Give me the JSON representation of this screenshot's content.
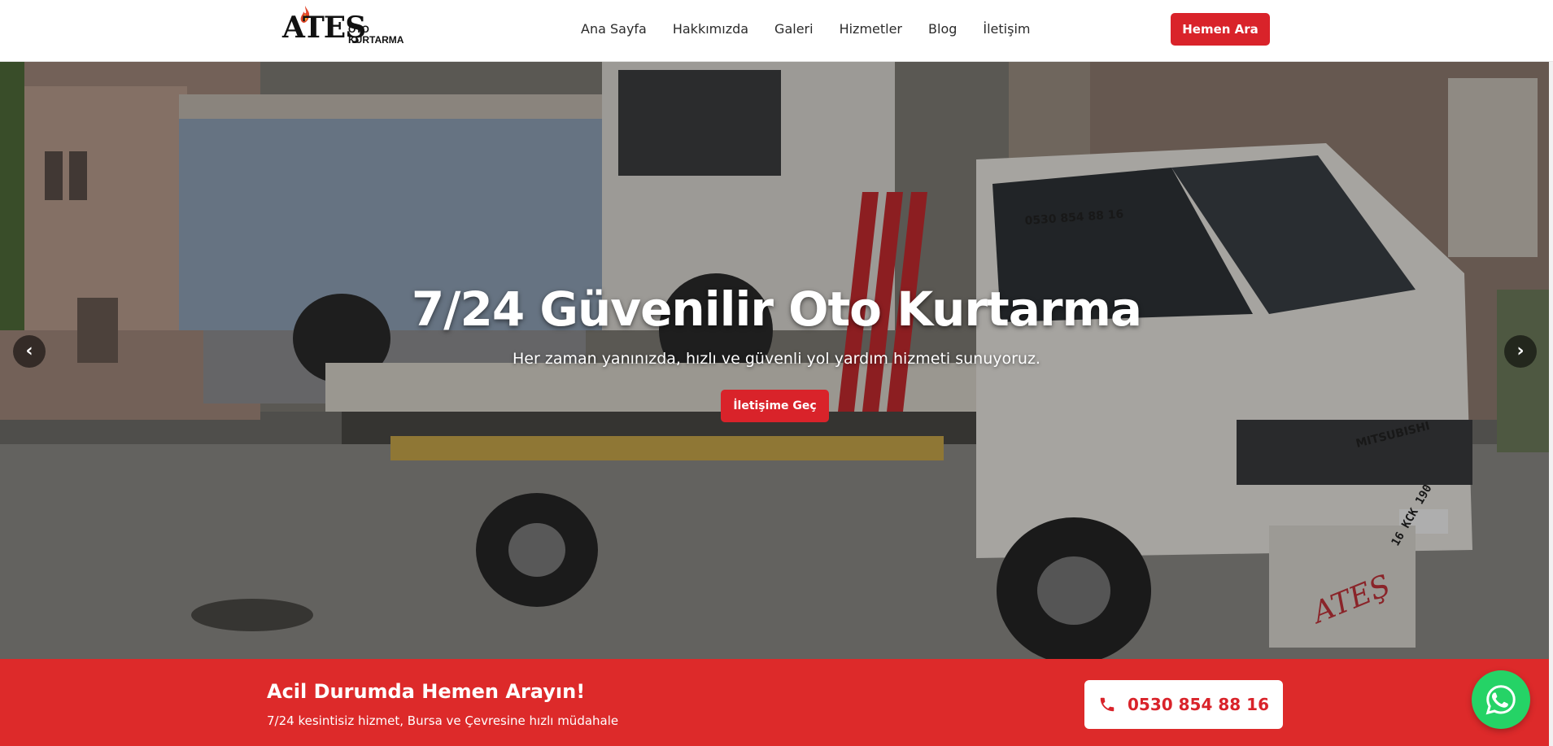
{
  "brand": {
    "logo_main": "ATEŞ",
    "logo_sub_1": "OTO",
    "logo_sub_2": "KURTARMA"
  },
  "nav": {
    "items": [
      {
        "label": "Ana Sayfa"
      },
      {
        "label": "Hakkımızda"
      },
      {
        "label": "Galeri"
      },
      {
        "label": "Hizmetler"
      },
      {
        "label": "Blog"
      },
      {
        "label": "İletişim"
      }
    ],
    "call_button": "Hemen Ara"
  },
  "hero": {
    "title": "7/24 Güvenilir Oto Kurtarma",
    "subtitle": "Her zaman yanınızda, hızlı ve güvenli yol yardım hizmeti sunuyoruz.",
    "cta": "İletişime Geç",
    "prev_arrow": "‹",
    "next_arrow": "›",
    "truck_phone": "0530 854 88 16",
    "truck_plate": "16 KCK 190",
    "truck_brand": "MITSUBISHI",
    "truck_decal": "ATEŞ"
  },
  "emergency": {
    "title": "Acil Durumda Hemen Arayın!",
    "subtitle": "7/24 kesintisiz hizmet, Bursa ve Çevresine hızlı müdahale",
    "phone": "0530 854 88 16"
  },
  "colors": {
    "accent": "#d9232a",
    "emergency_bg": "#dd2a2a",
    "whatsapp": "#25d366"
  },
  "icons": {
    "phone": "phone-icon",
    "whatsapp": "whatsapp-icon",
    "flame": "flame-icon"
  }
}
